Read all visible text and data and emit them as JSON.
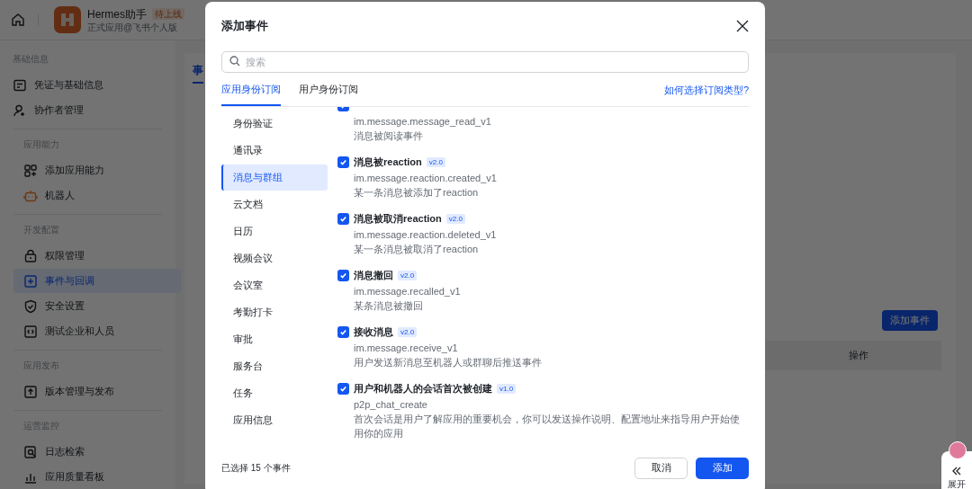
{
  "header": {
    "app_name": "Hermes助手",
    "badge": "待上线",
    "subtitle": "正式应用@飞书个人版"
  },
  "sidebar": {
    "groups": [
      {
        "title": "基础信息",
        "items": [
          {
            "label": "凭证与基础信息",
            "kind": "card",
            "selected": false
          },
          {
            "label": "协作者管理",
            "kind": "user",
            "selected": false
          }
        ]
      },
      {
        "title": "应用能力",
        "items": [
          {
            "label": "添加应用能力",
            "kind": "apps",
            "selected": false
          },
          {
            "label": "机器人",
            "kind": "robot",
            "selected": false
          }
        ]
      },
      {
        "title": "开发配置",
        "items": [
          {
            "label": "权限管理",
            "kind": "lock",
            "selected": false
          },
          {
            "label": "事件与回调",
            "kind": "event",
            "selected": true
          },
          {
            "label": "安全设置",
            "kind": "shield",
            "selected": false
          },
          {
            "label": "测试企业和人员",
            "kind": "code",
            "selected": false
          }
        ]
      },
      {
        "title": "应用发布",
        "items": [
          {
            "label": "版本管理与发布",
            "kind": "upload",
            "selected": false
          }
        ]
      },
      {
        "title": "运营监控",
        "items": [
          {
            "label": "日志检索",
            "kind": "log",
            "selected": false
          },
          {
            "label": "应用质量看板",
            "kind": "chart",
            "selected": false
          }
        ]
      }
    ]
  },
  "main": {
    "tab": "事",
    "add_button": "添加事件",
    "table_header": "操作"
  },
  "expand_widget": {
    "label": "展开"
  },
  "dialog": {
    "title": "添加事件",
    "search": {
      "placeholder": "搜索"
    },
    "tabs": [
      {
        "label": "应用身份订阅",
        "selected": true
      },
      {
        "label": "用户身份订阅",
        "selected": false
      }
    ],
    "help_link": "如何选择订阅类型?",
    "categories": [
      {
        "label": "身份验证",
        "selected": false
      },
      {
        "label": "通讯录",
        "selected": false
      },
      {
        "label": "消息与群组",
        "selected": true
      },
      {
        "label": "云文档",
        "selected": false
      },
      {
        "label": "日历",
        "selected": false
      },
      {
        "label": "视频会议",
        "selected": false
      },
      {
        "label": "会议室",
        "selected": false
      },
      {
        "label": "考勤打卡",
        "selected": false
      },
      {
        "label": "审批",
        "selected": false
      },
      {
        "label": "服务台",
        "selected": false
      },
      {
        "label": "任务",
        "selected": false
      },
      {
        "label": "应用信息",
        "selected": false
      }
    ],
    "events": [
      {
        "code": "im.message.message_read_v1",
        "description": "消息被阅读事件",
        "checked": true
      },
      {
        "name": "消息被reaction",
        "version": "v2.0",
        "code": "im.message.reaction.created_v1",
        "description": "某一条消息被添加了reaction",
        "checked": true
      },
      {
        "name": "消息被取消reaction",
        "version": "v2.0",
        "code": "im.message.reaction.deleted_v1",
        "description": "某一条消息被取消了reaction",
        "checked": true
      },
      {
        "name": "消息撤回",
        "version": "v2.0",
        "code": "im.message.recalled_v1",
        "description": "某条消息被撤回",
        "checked": true
      },
      {
        "name": "接收消息",
        "version": "v2.0",
        "code": "im.message.receive_v1",
        "description": "用户发送新消息至机器人或群聊后推送事件",
        "checked": true
      },
      {
        "name": "用户和机器人的会话首次被创建",
        "version": "v1.0",
        "code": "p2p_chat_create",
        "description": "首次会话是用户了解应用的重要机会，你可以发送操作说明、配置地址来指导用户开始使用你的应用",
        "checked": true
      }
    ],
    "selected_count": "已选择 15 个事件",
    "buttons": {
      "cancel": "取消",
      "confirm": "添加"
    }
  }
}
